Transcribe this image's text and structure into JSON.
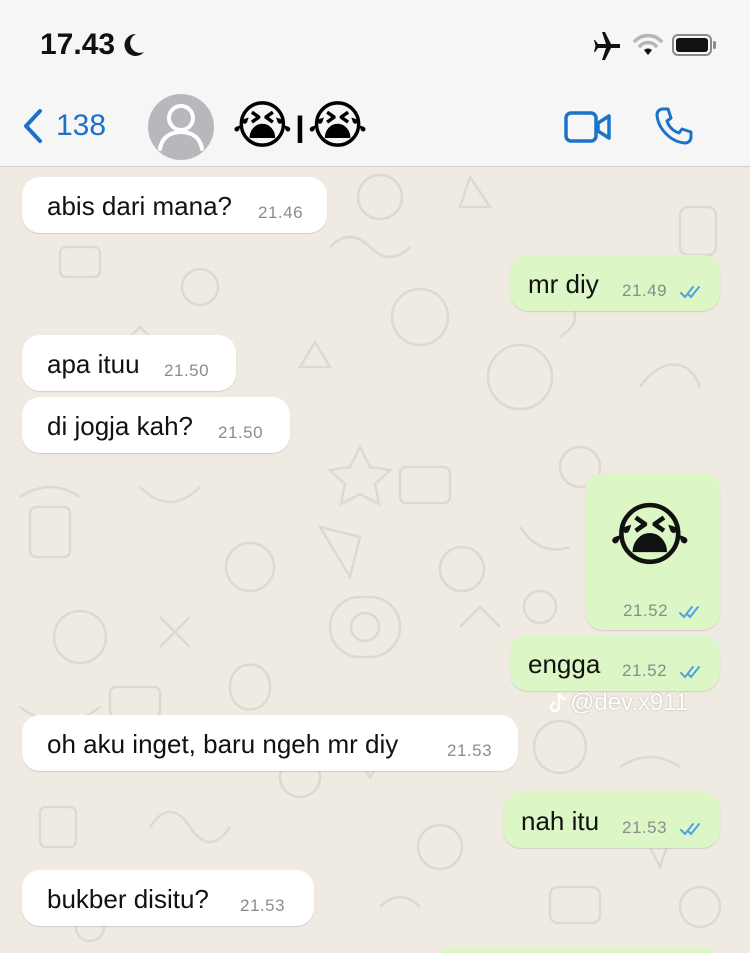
{
  "status_bar": {
    "time": "17.43",
    "icons": [
      "moon-icon",
      "airplane-icon",
      "wifi-icon",
      "battery-icon"
    ]
  },
  "header": {
    "back_count": "138",
    "contact_name": "😭ı😭",
    "icons": [
      "chevron-left-icon",
      "avatar-placeholder-icon",
      "video-call-icon",
      "phone-icon"
    ]
  },
  "colors": {
    "accent": "#1a73c8",
    "incoming_bubble": "#ffffff",
    "outgoing_bubble": "#dcf7c5",
    "chat_background": "#efeae2",
    "read_ticks": "#4fa3e0"
  },
  "messages": [
    {
      "direction": "in",
      "text": "abis dari mana?",
      "time": "21.46"
    },
    {
      "direction": "out",
      "text": "mr diy",
      "time": "21.49",
      "status": "read"
    },
    {
      "direction": "in",
      "text": "apa ituu",
      "time": "21.50"
    },
    {
      "direction": "in",
      "text": "di jogja kah?",
      "time": "21.50"
    },
    {
      "direction": "out",
      "text": "😭",
      "time": "21.52",
      "status": "read"
    },
    {
      "direction": "out",
      "text": "engga",
      "time": "21.52",
      "status": "read"
    },
    {
      "direction": "in",
      "text": "oh aku inget, baru ngeh mr diy",
      "time": "21.53"
    },
    {
      "direction": "out",
      "text": "nah itu",
      "time": "21.53",
      "status": "read"
    },
    {
      "direction": "in",
      "text": "bukber disitu?",
      "time": "21.53"
    }
  ],
  "watermark": "@dev.x911"
}
